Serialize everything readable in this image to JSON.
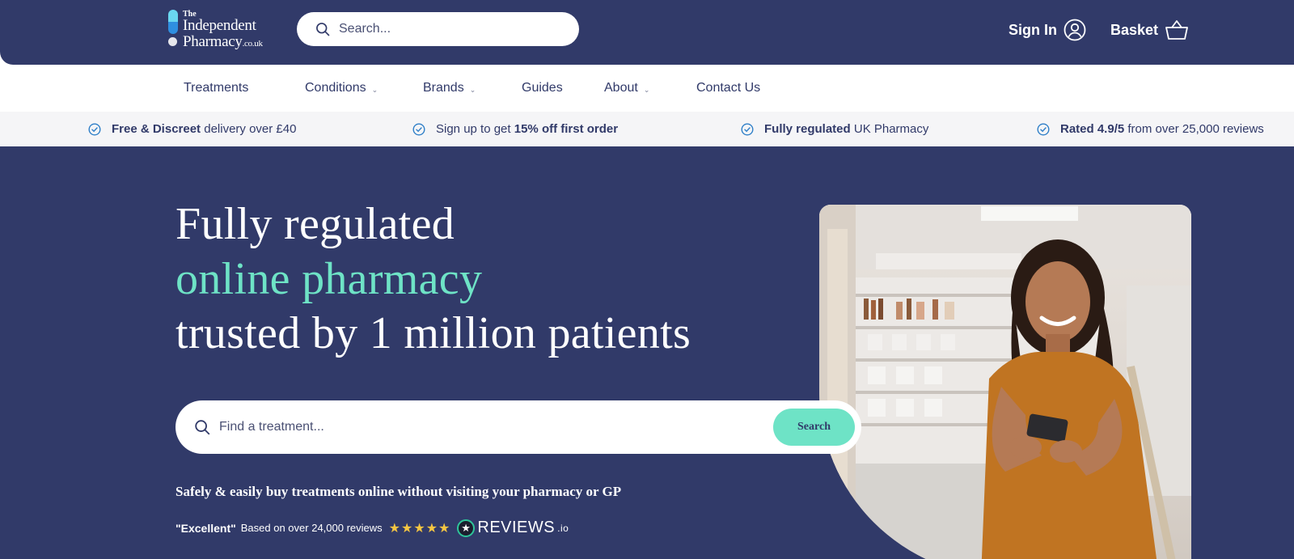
{
  "header": {
    "logo": {
      "the": "The",
      "line1": "Independent",
      "line2": "Pharmacy",
      "line2_suffix": ".co.uk"
    },
    "search": {
      "placeholder": "Search..."
    },
    "sign_in": "Sign In",
    "basket": "Basket"
  },
  "nav": {
    "items": [
      {
        "label": "Treatments",
        "dropdown": false
      },
      {
        "label": "Conditions",
        "dropdown": true
      },
      {
        "label": "Brands",
        "dropdown": true
      },
      {
        "label": "Guides",
        "dropdown": false
      },
      {
        "label": "About",
        "dropdown": true
      },
      {
        "label": "Contact Us",
        "dropdown": false
      }
    ],
    "chevron": "⌄"
  },
  "usp": [
    {
      "bold": "Free & Discreet",
      "text": " delivery over £40"
    },
    {
      "pre": "Sign up to get ",
      "bold": "15% off first order"
    },
    {
      "bold": "Fully regulated",
      "text": " UK Pharmacy"
    },
    {
      "bold": "Rated 4.9/5",
      "text": " from over 25,000 reviews"
    }
  ],
  "hero": {
    "line1": "Fully regulated",
    "line2": "online pharmacy",
    "line3": "trusted by 1 million patients",
    "search_placeholder": "Find a treatment...",
    "search_button": "Search",
    "tagline": "Safely & easily buy treatments online without visiting your pharmacy or GP",
    "rating_word": "\"Excellent\"",
    "rating_text": "Based on over 24,000 reviews",
    "stars": "★★★★★",
    "reviews_brand": "REVIEWS",
    "reviews_brand_suffix": ".io",
    "reviews_badge": "★"
  },
  "colors": {
    "navy": "#313a69",
    "mint": "#6ee3c6",
    "white": "#ffffff",
    "strip": "#f5f5f7",
    "star": "#f5c542"
  }
}
